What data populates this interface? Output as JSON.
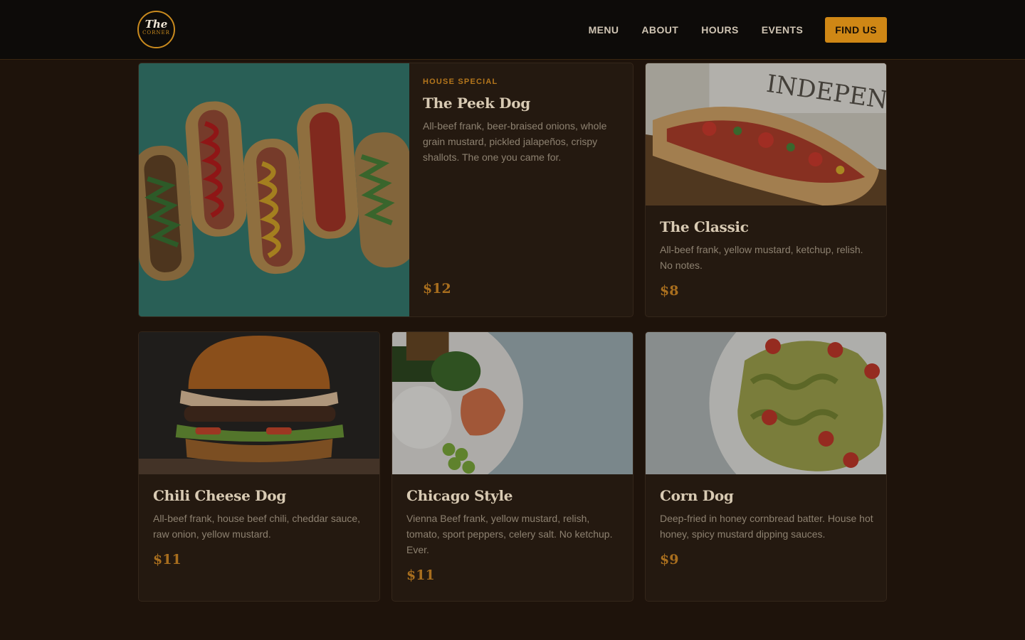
{
  "brand": {
    "logo_top": "The",
    "logo_bottom": "CORNER"
  },
  "nav": {
    "links": [
      "MENU",
      "ABOUT",
      "HOURS",
      "EVENTS"
    ],
    "cta": "FIND US"
  },
  "colors": {
    "accent": "#cf8715",
    "background": "#1e130b",
    "card": "#241910",
    "nav": "#0d0b09"
  },
  "items": {
    "featured": {
      "eyebrow": "HOUSE SPECIAL",
      "name": "The Peek Dog",
      "description": "All-beef frank, beer-braised onions, whole grain mustard, pickled jalapeños, crispy shallots. The one you came for.",
      "price": "$12"
    },
    "classic": {
      "name": "The Classic",
      "description": "All-beef frank, yellow mustard, ketchup, relish. No notes.",
      "price": "$8"
    },
    "chili": {
      "name": "Chili Cheese Dog",
      "description": "All-beef frank, house beef chili, cheddar sauce, raw onion, yellow mustard.",
      "price": "$11"
    },
    "chicago": {
      "name": "Chicago Style",
      "description": "Vienna Beef frank, yellow mustard, relish, tomato, sport peppers, celery salt. No ketchup. Ever.",
      "price": "$11"
    },
    "corn": {
      "name": "Corn Dog",
      "description": "Deep-fried in honey cornbread batter. House hot honey, spicy mustard dipping sauces.",
      "price": "$9"
    }
  }
}
